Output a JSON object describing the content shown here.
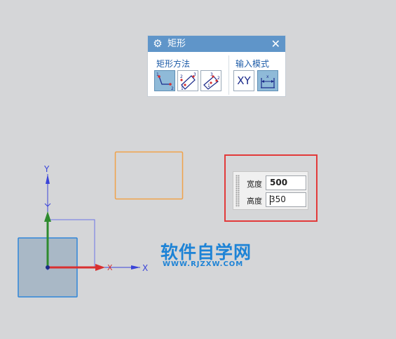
{
  "dialog": {
    "title": "矩形",
    "icon": "gear-icon",
    "close_icon": "close-icon",
    "close_symbol": "✕",
    "method_group": {
      "label": "矩形方法",
      "options": [
        {
          "name": "two-point-rectangle-icon",
          "active": true
        },
        {
          "name": "three-point-rectangle-icon",
          "active": false
        },
        {
          "name": "center-rectangle-icon",
          "active": false
        }
      ]
    },
    "input_mode_group": {
      "label": "输入模式",
      "options": [
        {
          "name": "xy-mode",
          "text": "XY",
          "active": false
        },
        {
          "name": "parameter-mode-icon",
          "active": true
        }
      ]
    }
  },
  "dynamic_input": {
    "width_label": "宽度",
    "width_value": "500",
    "height_label": "高度",
    "height_value": "350"
  },
  "axes": {
    "y_label": "Y",
    "x_label": "X",
    "x_arrow_label": "X",
    "y_arrow_label": "Y"
  },
  "watermark": {
    "title": "软件自学网",
    "url": "WWW.RJZXW.COM"
  },
  "colors": {
    "background": "#d5d6d8",
    "dialog_header": "#5f95c9",
    "preview_rectangle": "#f0a24a",
    "highlight_box": "#e23a3a",
    "axis_blue": "#3a44d8",
    "x_arrow": "#d93030",
    "y_arrow": "#2e8b2e",
    "watermark": "#1d83d6"
  }
}
